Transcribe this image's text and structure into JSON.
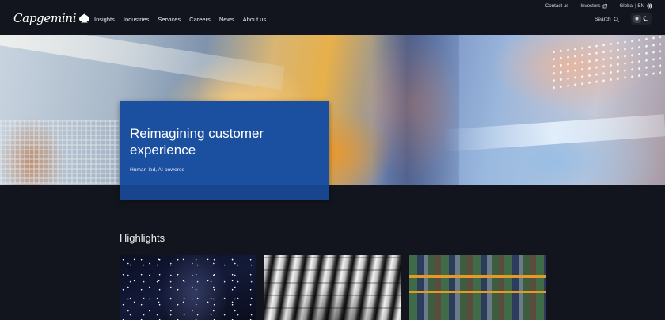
{
  "header": {
    "logo_text": "Capgemini",
    "nav": [
      "Insights",
      "Industries",
      "Services",
      "Careers",
      "News",
      "About us"
    ],
    "utility": {
      "contact": "Contact us",
      "investors": "Investors",
      "region": "Global | EN"
    },
    "search_label": "Search"
  },
  "hero": {
    "title": "Reimagining customer experience",
    "subtitle": "Human-led, AI-powered"
  },
  "highlights": {
    "title": "Highlights"
  },
  "icons": {
    "logo_mark": "spade-icon",
    "investors": "external-link-icon",
    "region": "globe-icon",
    "search": "search-icon",
    "theme_light": "sun-icon",
    "theme_dark": "moon-icon"
  }
}
